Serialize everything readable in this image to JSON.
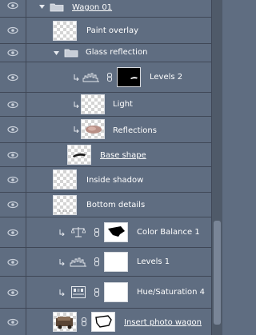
{
  "layers": [
    {
      "name": "Wagon 01",
      "type": "group",
      "state": "expanded"
    },
    {
      "name": "Paint overlay",
      "type": "layer",
      "thumb": "transparent"
    },
    {
      "name": "Glass reflection",
      "type": "group",
      "state": "expanded"
    },
    {
      "name": "Levels 2",
      "type": "adjustment",
      "adjustment_icon": "levels-icon",
      "mask": "black-with-white-shape",
      "clipped": true
    },
    {
      "name": "Light",
      "type": "layer",
      "thumb": "transparent",
      "clipped": true
    },
    {
      "name": "Reflections",
      "type": "layer",
      "thumb": "reflection-photo",
      "clipped": true
    },
    {
      "name": "Base shape",
      "type": "layer",
      "thumb": "shape",
      "underlined": true
    },
    {
      "name": "Inside shadow",
      "type": "layer",
      "thumb": "transparent"
    },
    {
      "name": "Bottom details",
      "type": "layer",
      "thumb": "transparent"
    },
    {
      "name": "Color Balance 1",
      "type": "adjustment",
      "adjustment_icon": "balance-scale-icon",
      "mask": "white-with-black-shape",
      "clipped": true
    },
    {
      "name": "Levels 1",
      "type": "adjustment",
      "adjustment_icon": "levels-icon",
      "mask": "white",
      "clipped": true
    },
    {
      "name": "Hue/Saturation 4",
      "type": "adjustment",
      "adjustment_icon": "hue-saturation-icon",
      "mask": "white",
      "clipped": true
    },
    {
      "name": "Insert photo wagon",
      "type": "layer",
      "thumb": "wagon-photo",
      "mask": "black-outline-on-white",
      "underlined": true
    }
  ],
  "colors": {
    "panel_bg": "#5f6d81",
    "row_border": "#3f4756",
    "text": "#ffffff",
    "scrollbar_track": "#4f5a69",
    "scrollbar_thumb": "#798597"
  }
}
